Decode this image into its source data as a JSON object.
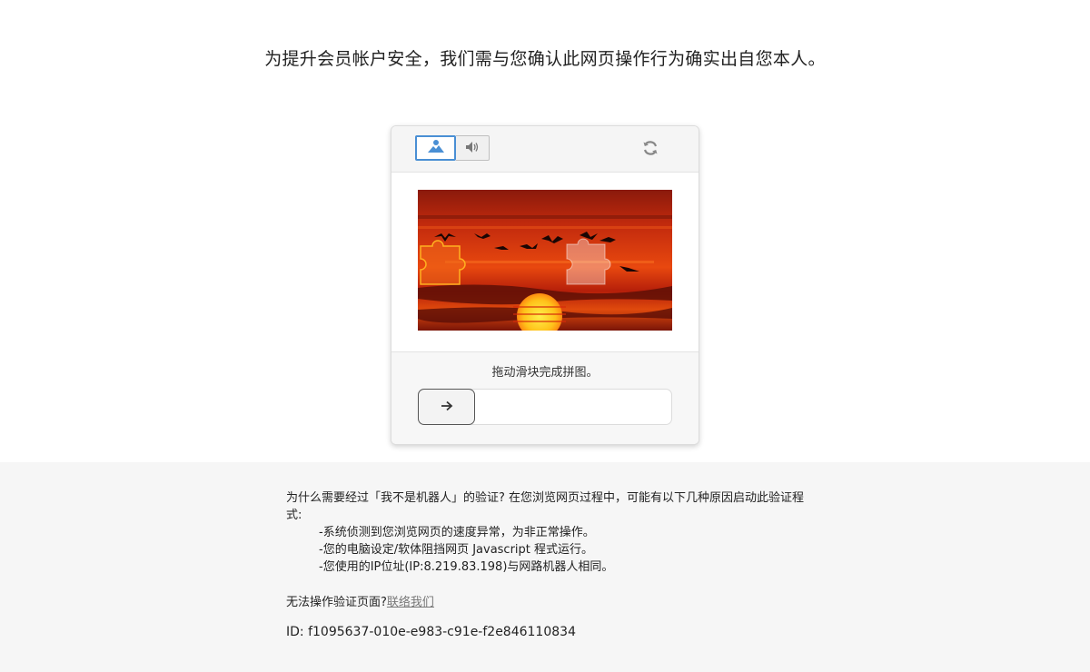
{
  "headline": "为提升会员帐户安全，我们需与您确认此网页操作行为确实出自您本人。",
  "captcha": {
    "modes": [
      {
        "icon": "image-mode-icon",
        "active": true
      },
      {
        "icon": "audio-mode-icon",
        "active": false
      }
    ],
    "refresh_icon": "refresh-icon",
    "instruction": "拖动滑块完成拼图。",
    "slider_icon": "arrow-right-icon",
    "accent_color": "#4a8fd4"
  },
  "info": {
    "why_text": "为什么需要经过「我不是机器人」的验证? 在您浏览网页过程中，可能有以下几种原因启动此验证程式:",
    "reasons": [
      "-系统侦测到您浏览网页的速度异常，为非正常操作。",
      "-您的电脑设定/软体阻挡网页 Javascript 程式运行。",
      "-您使用的IP位址(IP:8.219.83.198)与网路机器人相同。"
    ],
    "help_text": "无法操作验证页面?",
    "contact_link": "联络我们",
    "id_text": "ID: f1095637-010e-e983-c91e-f2e846110834"
  }
}
